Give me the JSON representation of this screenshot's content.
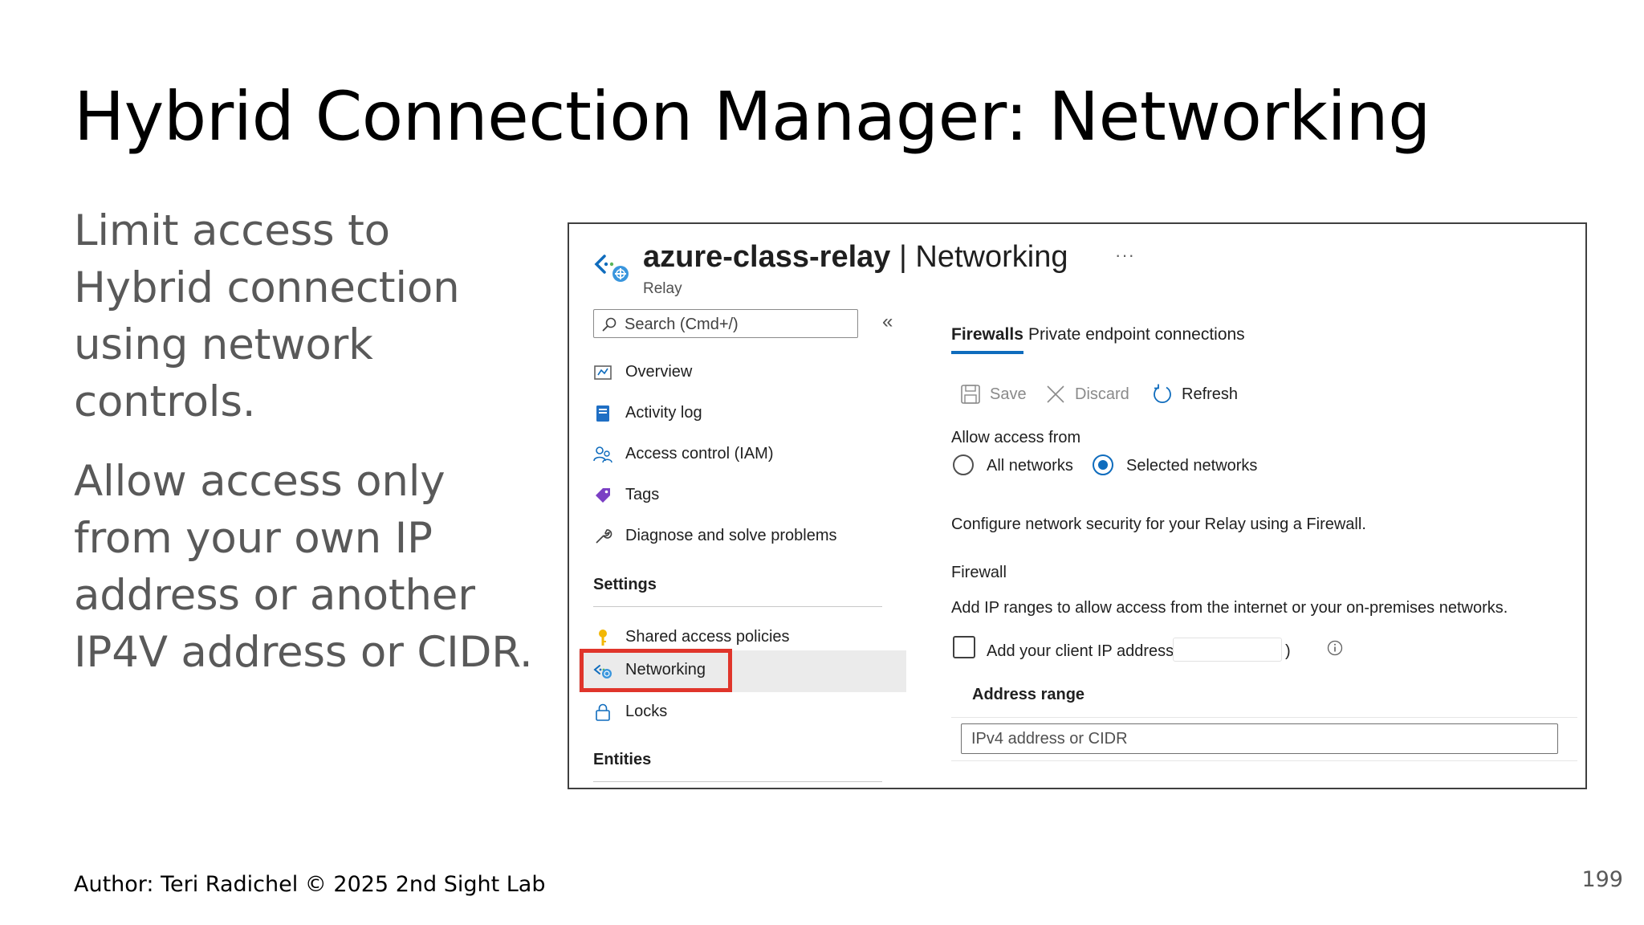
{
  "slide": {
    "title": "Hybrid Connection Manager: Networking",
    "bullets": [
      "Limit access to Hybrid connection using network controls.",
      "Allow access only from your own IP address or another IP4V address or CIDR."
    ],
    "author": "Author: Teri Radichel © 2025 2nd Sight Lab",
    "page_number": "199"
  },
  "portal": {
    "resource_name": "azure-class-relay",
    "separator": " | ",
    "blade_title": "Networking",
    "resource_type": "Relay",
    "more_icon": "···",
    "search_placeholder": "Search (Cmd+/)",
    "collapse_icon": "«",
    "nav": {
      "items": [
        {
          "label": "Overview",
          "icon": "overview-icon"
        },
        {
          "label": "Activity log",
          "icon": "activity-log-icon"
        },
        {
          "label": "Access control (IAM)",
          "icon": "iam-icon"
        },
        {
          "label": "Tags",
          "icon": "tag-icon"
        },
        {
          "label": "Diagnose and solve problems",
          "icon": "wrench-icon"
        }
      ],
      "settings_header": "Settings",
      "settings_items": [
        {
          "label": "Shared access policies",
          "icon": "key-icon"
        },
        {
          "label": "Networking",
          "icon": "networking-icon",
          "selected": true
        },
        {
          "label": "Locks",
          "icon": "lock-icon"
        }
      ],
      "entities_header": "Entities"
    },
    "tabs": [
      {
        "label": "Firewalls",
        "active": true
      },
      {
        "label": "Private endpoint connections",
        "active": false
      }
    ],
    "toolbar": {
      "save": "Save",
      "discard": "Discard",
      "refresh": "Refresh"
    },
    "access": {
      "label": "Allow access from",
      "options": [
        "All networks",
        "Selected networks"
      ],
      "selected": "Selected networks"
    },
    "description": "Configure network security for your Relay using a Firewall.",
    "firewall": {
      "heading": "Firewall",
      "description": "Add IP ranges to allow access from the internet or your on-premises networks.",
      "client_ip_prefix": "Add your client IP address (‘",
      "client_ip_suffix": ")",
      "address_range_header": "Address range",
      "address_placeholder": "IPv4 address or CIDR"
    },
    "colors": {
      "accent": "#0f6cbd",
      "highlight": "#e0352b"
    }
  }
}
